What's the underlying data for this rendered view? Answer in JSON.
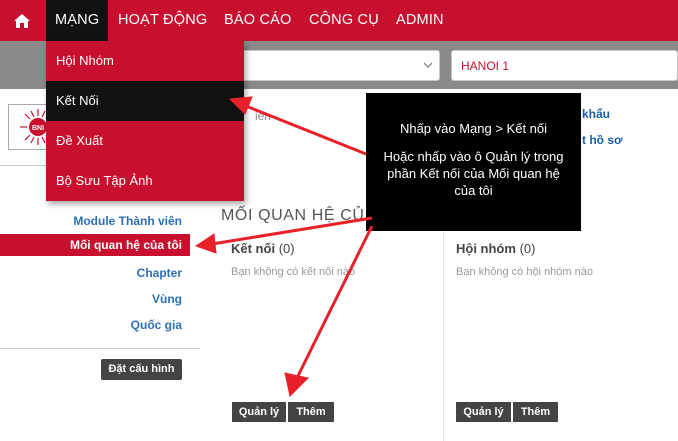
{
  "nav": {
    "items": [
      "MẠNG",
      "HOẠT ĐỘNG",
      "BÁO CÁO",
      "CÔNG CỤ",
      "ADMIN"
    ],
    "home_icon": "home-icon"
  },
  "filters": {
    "region_value": "HANOI 1"
  },
  "dropdown": {
    "items": [
      "Hội Nhóm",
      "Kết Nối",
      "Đề Xuất",
      "Bộ Sưu Tập Ảnh"
    ]
  },
  "profile": {
    "field_fragment": "iên",
    "logo_text": "BNI",
    "link_1": "khẩu",
    "link_2": "t hồ sơ"
  },
  "sidebar": {
    "items": [
      "Module Thành viên",
      "Mối quan hệ của tôi",
      "Chapter",
      "Vùng",
      "Quốc gia"
    ],
    "config_button": "Đặt cấu hình"
  },
  "main": {
    "title": "MỐI QUAN HỆ CỦ",
    "panels": [
      {
        "title": "Kết nối",
        "count": "(0)",
        "empty": "Bạn không có kết nối nào",
        "manage": "Quản lý",
        "add": "Thêm"
      },
      {
        "title": "Hội nhóm",
        "count": "(0)",
        "empty": "Bạn không có hội nhóm nào",
        "manage": "Quản lý",
        "add": "Thêm"
      }
    ]
  },
  "callout": {
    "line_1": "Nhấp vào Mạng > Kết nối",
    "line_2": "Hoặc nhấp vào ô Quản lý trong phần Kết nối của Mối quan hệ của tôi"
  },
  "colors": {
    "brand_red": "#c8102e",
    "nav_active": "#111111",
    "filter_bar": "#8a8a8a",
    "link_blue": "#2e6fb5",
    "arrow_red": "#e8202a"
  }
}
